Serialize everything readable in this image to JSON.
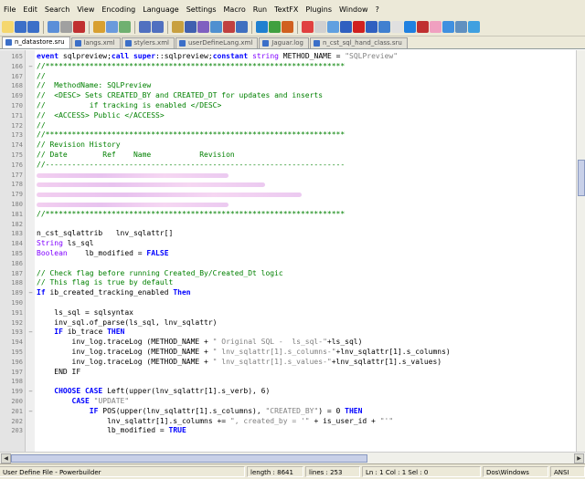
{
  "menu": [
    "File",
    "Edit",
    "Search",
    "View",
    "Encoding",
    "Language",
    "Settings",
    "Macro",
    "Run",
    "TextFX",
    "Plugins",
    "Window",
    "?"
  ],
  "tabs": [
    "n_datastore.sru",
    "langs.xml",
    "stylers.xml",
    "userDefineLang.xml",
    "Jaguar.log",
    "n_cst_sql_hand_class.sru"
  ],
  "active_tab": 0,
  "toolbar_colors": [
    "#f5d76e",
    "#3b6fc8",
    "#3b6fc8",
    "sep",
    "#5b8fd8",
    "#a0a0a0",
    "#c03030",
    "sep",
    "#d8a030",
    "#6a9adc",
    "#70b070",
    "sep",
    "#5070c0",
    "#5070c0",
    "sep",
    "#c8a040",
    "#4060b0",
    "#8060c0",
    "#5090d0",
    "#c04040",
    "#4070c0",
    "sep",
    "#2080d0",
    "#40a040",
    "#d06020",
    "sep",
    "#e04040",
    "#d0d0d0",
    "#60a0e0",
    "#3060c0",
    "#d02020",
    "#3060c0",
    "#4080d0",
    "#e0e0e0",
    "#2080e0",
    "#c03030",
    "#f0a0c0",
    "#4090e0",
    "#6090c0",
    "#40a0e0"
  ],
  "lines": [
    {
      "n": "165",
      "f": "",
      "t": "event sqlpreview;call super::sqlpreview;constant string METHOD_NAME = \"SQLPreview\"",
      "c": "kw1"
    },
    {
      "n": "166",
      "f": "−",
      "t": "//********************************************************************",
      "c": "cm"
    },
    {
      "n": "167",
      "f": "",
      "t": "//",
      "c": "cm"
    },
    {
      "n": "168",
      "f": "",
      "t": "//  MethodName: SQLPreview",
      "c": "cm"
    },
    {
      "n": "169",
      "f": "",
      "t": "//  <DESC> Sets CREATED_BY and CREATED_DT for updates and inserts",
      "c": "cm"
    },
    {
      "n": "170",
      "f": "",
      "t": "//          if tracking is enabled </DESC>",
      "c": "cm"
    },
    {
      "n": "171",
      "f": "",
      "t": "//  <ACCESS> Public </ACCESS>",
      "c": "cm"
    },
    {
      "n": "172",
      "f": "",
      "t": "//",
      "c": "cm"
    },
    {
      "n": "173",
      "f": "",
      "t": "//********************************************************************",
      "c": "cm"
    },
    {
      "n": "174",
      "f": "",
      "t": "// Revision History",
      "c": "cm"
    },
    {
      "n": "175",
      "f": "",
      "t": "// Date        Ref    Name           Revision",
      "c": "cm"
    },
    {
      "n": "176",
      "f": "",
      "t": "//--------------------------------------------------------------------",
      "c": "cm"
    },
    {
      "n": "177",
      "f": "",
      "t": "",
      "c": "blur"
    },
    {
      "n": "178",
      "f": "",
      "t": "",
      "c": "blur"
    },
    {
      "n": "179",
      "f": "",
      "t": "",
      "c": "blur"
    },
    {
      "n": "180",
      "f": "",
      "t": "",
      "c": "blur"
    },
    {
      "n": "181",
      "f": "",
      "t": "//********************************************************************",
      "c": "cm"
    },
    {
      "n": "182",
      "f": "",
      "t": "",
      "c": ""
    },
    {
      "n": "183",
      "f": "",
      "t": "n_cst_sqlattrib   lnv_sqlattr[]",
      "c": ""
    },
    {
      "n": "184",
      "f": "",
      "t": "String ls_sql",
      "c": "ty1"
    },
    {
      "n": "185",
      "f": "",
      "t": "Boolean    lb_modified = FALSE",
      "c": "ty2"
    },
    {
      "n": "186",
      "f": "",
      "t": "",
      "c": ""
    },
    {
      "n": "187",
      "f": "",
      "t": "// Check flag before running Created_By/Created_Dt logic",
      "c": "cm"
    },
    {
      "n": "188",
      "f": "",
      "t": "// This flag is true by default",
      "c": "cm"
    },
    {
      "n": "189",
      "f": "−",
      "t": "If ib_created_tracking_enabled Then",
      "c": "if1"
    },
    {
      "n": "190",
      "f": "",
      "t": "",
      "c": ""
    },
    {
      "n": "191",
      "f": "",
      "t": "    ls_sql = sqlsyntax",
      "c": ""
    },
    {
      "n": "192",
      "f": "",
      "t": "    inv_sql.of_parse(ls_sql, lnv_sqlattr)",
      "c": ""
    },
    {
      "n": "193",
      "f": "−",
      "t": "    IF ib_trace THEN",
      "c": "if2"
    },
    {
      "n": "194",
      "f": "",
      "t": "        inv_log.traceLog (METHOD_NAME + \" Original SQL -  ls_sql-\"+ls_sql)",
      "c": ""
    },
    {
      "n": "195",
      "f": "",
      "t": "        inv_log.traceLog (METHOD_NAME + \" lnv_sqlattr[1].s_columns-\"+lnv_sqlattr[1].s_columns)",
      "c": ""
    },
    {
      "n": "196",
      "f": "",
      "t": "        inv_log.traceLog (METHOD_NAME + \" lnv_sqlattr[1].s_values-\"+lnv_sqlattr[1].s_values)",
      "c": ""
    },
    {
      "n": "197",
      "f": "",
      "t": "    END IF",
      "c": ""
    },
    {
      "n": "198",
      "f": "",
      "t": "",
      "c": ""
    },
    {
      "n": "199",
      "f": "−",
      "t": "    CHOOSE CASE Left(upper(lnv_sqlattr[1].s_verb), 6)",
      "c": "case1"
    },
    {
      "n": "200",
      "f": "",
      "t": "        CASE \"UPDATE\"",
      "c": "case2"
    },
    {
      "n": "201",
      "f": "−",
      "t": "            IF POS(upper(lnv_sqlattr[1].s_columns), \"CREATED_BY\") = 0 THEN",
      "c": "if3"
    },
    {
      "n": "202",
      "f": "",
      "t": "                lnv_sqlattr[1].s_columns += \", created_by = '\" + is_user_id + \"'\"",
      "c": ""
    },
    {
      "n": "203",
      "f": "",
      "t": "                lb_modified = TRUE",
      "c": "true1"
    }
  ],
  "status": {
    "type": "User Define File - Powerbuilder",
    "length": "length : 8641",
    "lines": "lines : 253",
    "pos": "Ln : 1    Col : 1    Sel : 0",
    "eol": "Dos\\Windows",
    "enc": "ANSI"
  }
}
